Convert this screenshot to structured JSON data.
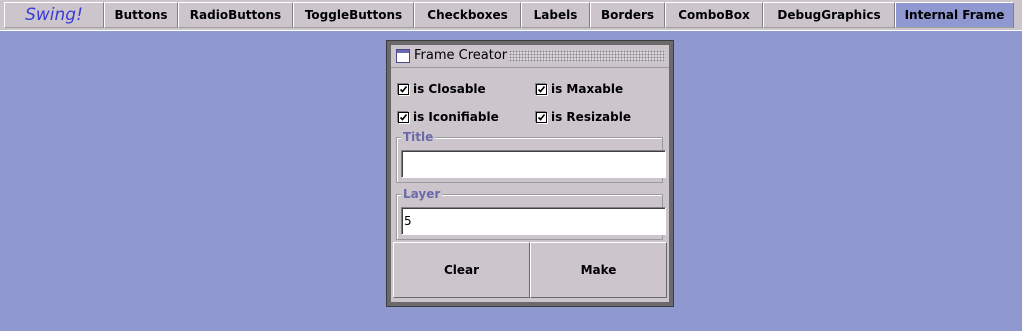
{
  "tabs": [
    {
      "label": "Swing!",
      "selected": false
    },
    {
      "label": "Buttons",
      "selected": false
    },
    {
      "label": "RadioButtons",
      "selected": false
    },
    {
      "label": "ToggleButtons",
      "selected": false
    },
    {
      "label": "Checkboxes",
      "selected": false
    },
    {
      "label": "Labels",
      "selected": false
    },
    {
      "label": "Borders",
      "selected": false
    },
    {
      "label": "ComboBox",
      "selected": false
    },
    {
      "label": "DebugGraphics",
      "selected": false
    },
    {
      "label": "Internal Frame",
      "selected": true
    }
  ],
  "frame": {
    "title": "Frame Creator",
    "icon": "window-icon",
    "options": {
      "closable": {
        "label": "is Closable",
        "checked": true
      },
      "maxable": {
        "label": "is Maxable",
        "checked": true
      },
      "iconifiable": {
        "label": "is Iconifiable",
        "checked": true
      },
      "resizable": {
        "label": "is Resizable",
        "checked": true
      }
    },
    "title_group": {
      "label": "Title",
      "value": ""
    },
    "layer_group": {
      "label": "Layer",
      "value": "5"
    },
    "clear_label": "Clear",
    "make_label": "Make"
  },
  "colors": {
    "desktop": "#8f98d0",
    "panel": "#ccc6cc",
    "selected_tab": "#8f98d0",
    "logo_text": "#3a3ad8",
    "group_label": "#6a6aa8"
  }
}
